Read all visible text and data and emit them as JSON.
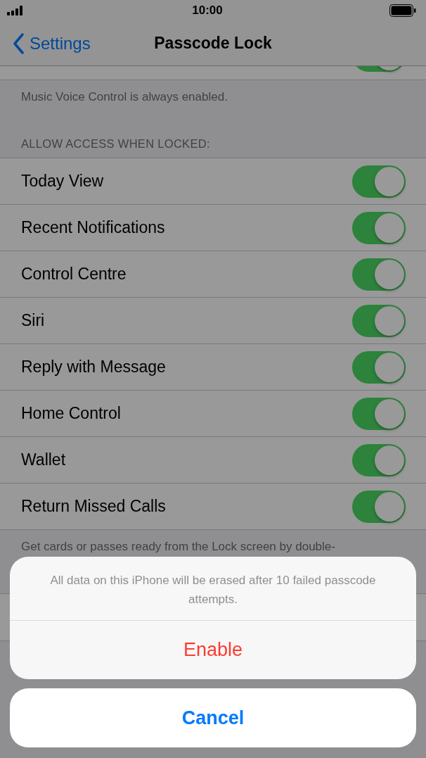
{
  "status_bar": {
    "time": "10:00"
  },
  "nav": {
    "back_label": "Settings",
    "title": "Passcode Lock"
  },
  "partial_row": {
    "on": true
  },
  "partial_footer": "Music Voice Control is always enabled.",
  "section_header": "ALLOW ACCESS WHEN LOCKED:",
  "rows": [
    {
      "label": "Today View",
      "on": true
    },
    {
      "label": "Recent Notifications",
      "on": true
    },
    {
      "label": "Control Centre",
      "on": true
    },
    {
      "label": "Siri",
      "on": true
    },
    {
      "label": "Reply with Message",
      "on": true
    },
    {
      "label": "Home Control",
      "on": true
    },
    {
      "label": "Wallet",
      "on": true
    },
    {
      "label": "Return Missed Calls",
      "on": true
    }
  ],
  "section_footer": "Get cards or passes ready from the Lock screen by double-",
  "action_sheet": {
    "message": "All data on this iPhone will be erased after 10 failed passcode attempts.",
    "actions": [
      {
        "label": "Enable",
        "kind": "destructive"
      }
    ],
    "cancel": "Cancel"
  }
}
